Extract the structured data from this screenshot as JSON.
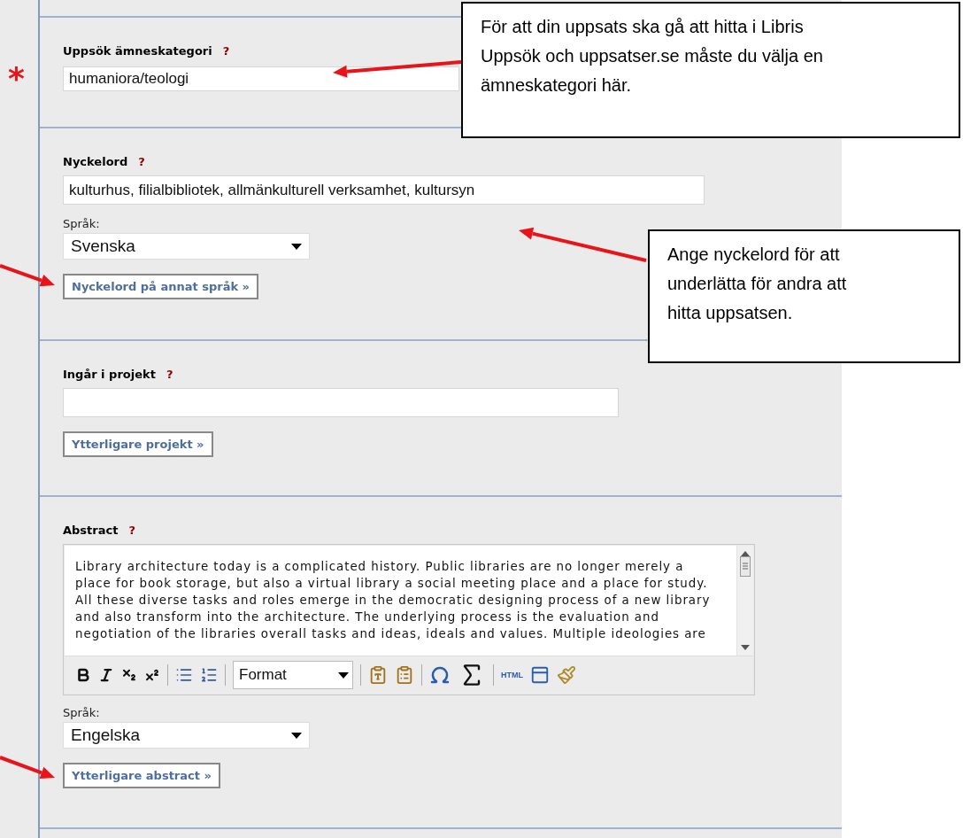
{
  "required_mark": "*",
  "sections": [
    {
      "kind": "category",
      "label": "Uppsök ämneskategori",
      "help": "?",
      "value": "humaniora/teologi",
      "callout": "För att din uppsats ska gå att hitta i Libris Uppsök och uppsatser.se måste du välja en ämneskategori här."
    },
    {
      "kind": "keywords",
      "label": "Nyckelord",
      "help": "?",
      "value": "kulturhus, filialbibliotek, allmänkulturell verksamhet, kultursyn",
      "language": {
        "label": "Språk:",
        "value": "Svenska"
      },
      "button": "Nyckelord på annat språk »",
      "callout": "Ange nyckelord för att underlätta för andra att hitta uppsatsen."
    },
    {
      "kind": "project",
      "label": "Ingår i projekt",
      "help": "?",
      "button": "Ytterligare projekt »"
    },
    {
      "kind": "abstract",
      "label": "Abstract",
      "help": "?",
      "editor": {
        "text": "Library architecture today is a complicated history. Public libraries are no longer merely a place for book storage, but also a virtual library a social meeting place and a place for study. All these diverse tasks and roles emerge in the democratic designing process of a new library and also transform into the architecture. The underlying process is the evaluation and negotiation of the libraries overall tasks and ideas, ideals and values. Multiple ideologies are",
        "format_label": "Format",
        "html_label": "HTML"
      },
      "language": {
        "label": "Språk:",
        "value": "Engelska"
      },
      "button": "Ytterligare abstract »"
    }
  ]
}
